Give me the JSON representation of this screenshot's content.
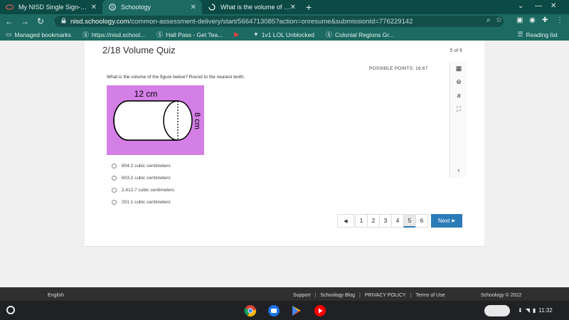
{
  "browser": {
    "tabs": [
      {
        "label": "My NISD Single Sign-On Portal",
        "icon": "nisd-logo-icon"
      },
      {
        "label": "Schoology",
        "icon": "schoology-icon"
      },
      {
        "label": "What is the volume of the figure",
        "icon": "loading-icon"
      }
    ],
    "url_host": "nisd.schoology.com",
    "url_path": "/common-assessment-delivery/start/5664713085?action=onresume&submissionId=776229142",
    "bookmarks": [
      {
        "label": "Managed bookmarks",
        "icon": "folder-icon"
      },
      {
        "label": "https://nisd.school...",
        "icon": "schoology-icon"
      },
      {
        "label": "Hall Pass - Get Tea...",
        "icon": "schoology-icon"
      },
      {
        "label": "",
        "icon": "youtube-icon"
      },
      {
        "label": "1v1 LOL Unblocked",
        "icon": "game-icon"
      },
      {
        "label": "Colonial Regions Gr...",
        "icon": "schoology-icon"
      }
    ],
    "reading_list": "Reading list"
  },
  "quiz": {
    "title": "2/18 Volume Quiz",
    "page_count": "5 of 6",
    "possible_points": "POSSIBLE POINTS: 16.67",
    "question": "What is the volume of the figure below? Round to the nearest tenth.",
    "figure": {
      "length_label": "12 cm",
      "diameter_label": "8 cm",
      "background": "#d47fe6"
    },
    "options": [
      "804.2 cubic centimeters",
      "603.2 cubic centimeters",
      "2,412.7 cubic centimeters",
      "201.1 cubic centimeters"
    ],
    "pages": [
      "1",
      "2",
      "3",
      "4",
      "5",
      "6"
    ],
    "current_page": "5",
    "next_label": "Next"
  },
  "footer": {
    "language": "English",
    "links": [
      "Support",
      "Schoology Blog",
      "PRIVACY POLICY",
      "Terms of Use"
    ],
    "copyright": "Schoology © 2022"
  },
  "shelf": {
    "apps": [
      "chrome-icon",
      "files-icon",
      "play-store-icon",
      "youtube-icon"
    ],
    "time": "11:32"
  },
  "colors": {
    "accent": "#2b7bb9",
    "chrome_dark": "#0c4a45",
    "chrome": "#1c6a62"
  }
}
